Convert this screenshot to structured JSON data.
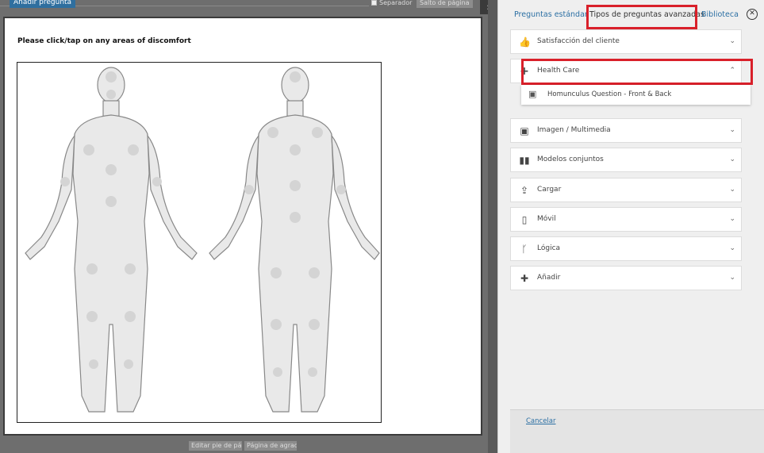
{
  "toolbar": {
    "add_question": "Añadir pregunta",
    "separator_label": "Separador",
    "page_break": "Salto de página",
    "collapse_icon": "chevron-right-icon"
  },
  "question": {
    "title": "Please click/tap on any areas of discomfort"
  },
  "footer": {
    "edit_footer": "Editar pie de pág",
    "add_page": "Página de agrade"
  },
  "panel": {
    "tabs": [
      {
        "label": "Preguntas estándar"
      },
      {
        "label": "Tipos de preguntas avanzadas"
      },
      {
        "label": "Biblioteca"
      }
    ],
    "categories": [
      {
        "label": "Satisfacción del cliente",
        "icon": "thumbs-up-icon"
      },
      {
        "label": "Health Care",
        "icon": "plus-icon"
      },
      {
        "label": "Imagen / Multimedia",
        "icon": "image-icon"
      },
      {
        "label": "Modelos conjuntos",
        "icon": "conjoint-icon"
      },
      {
        "label": "Cargar",
        "icon": "upload-icon"
      },
      {
        "label": "Móvil",
        "icon": "mobile-icon"
      },
      {
        "label": "Lógica",
        "icon": "logic-icon"
      },
      {
        "label": "Añadir",
        "icon": "puzzle-icon"
      }
    ],
    "health_care_item": "Homunculus Question - Front & Back",
    "cancel": "Cancelar"
  },
  "colors": {
    "accent_blue": "#2b6fa3",
    "highlight_red": "#d9202a"
  }
}
